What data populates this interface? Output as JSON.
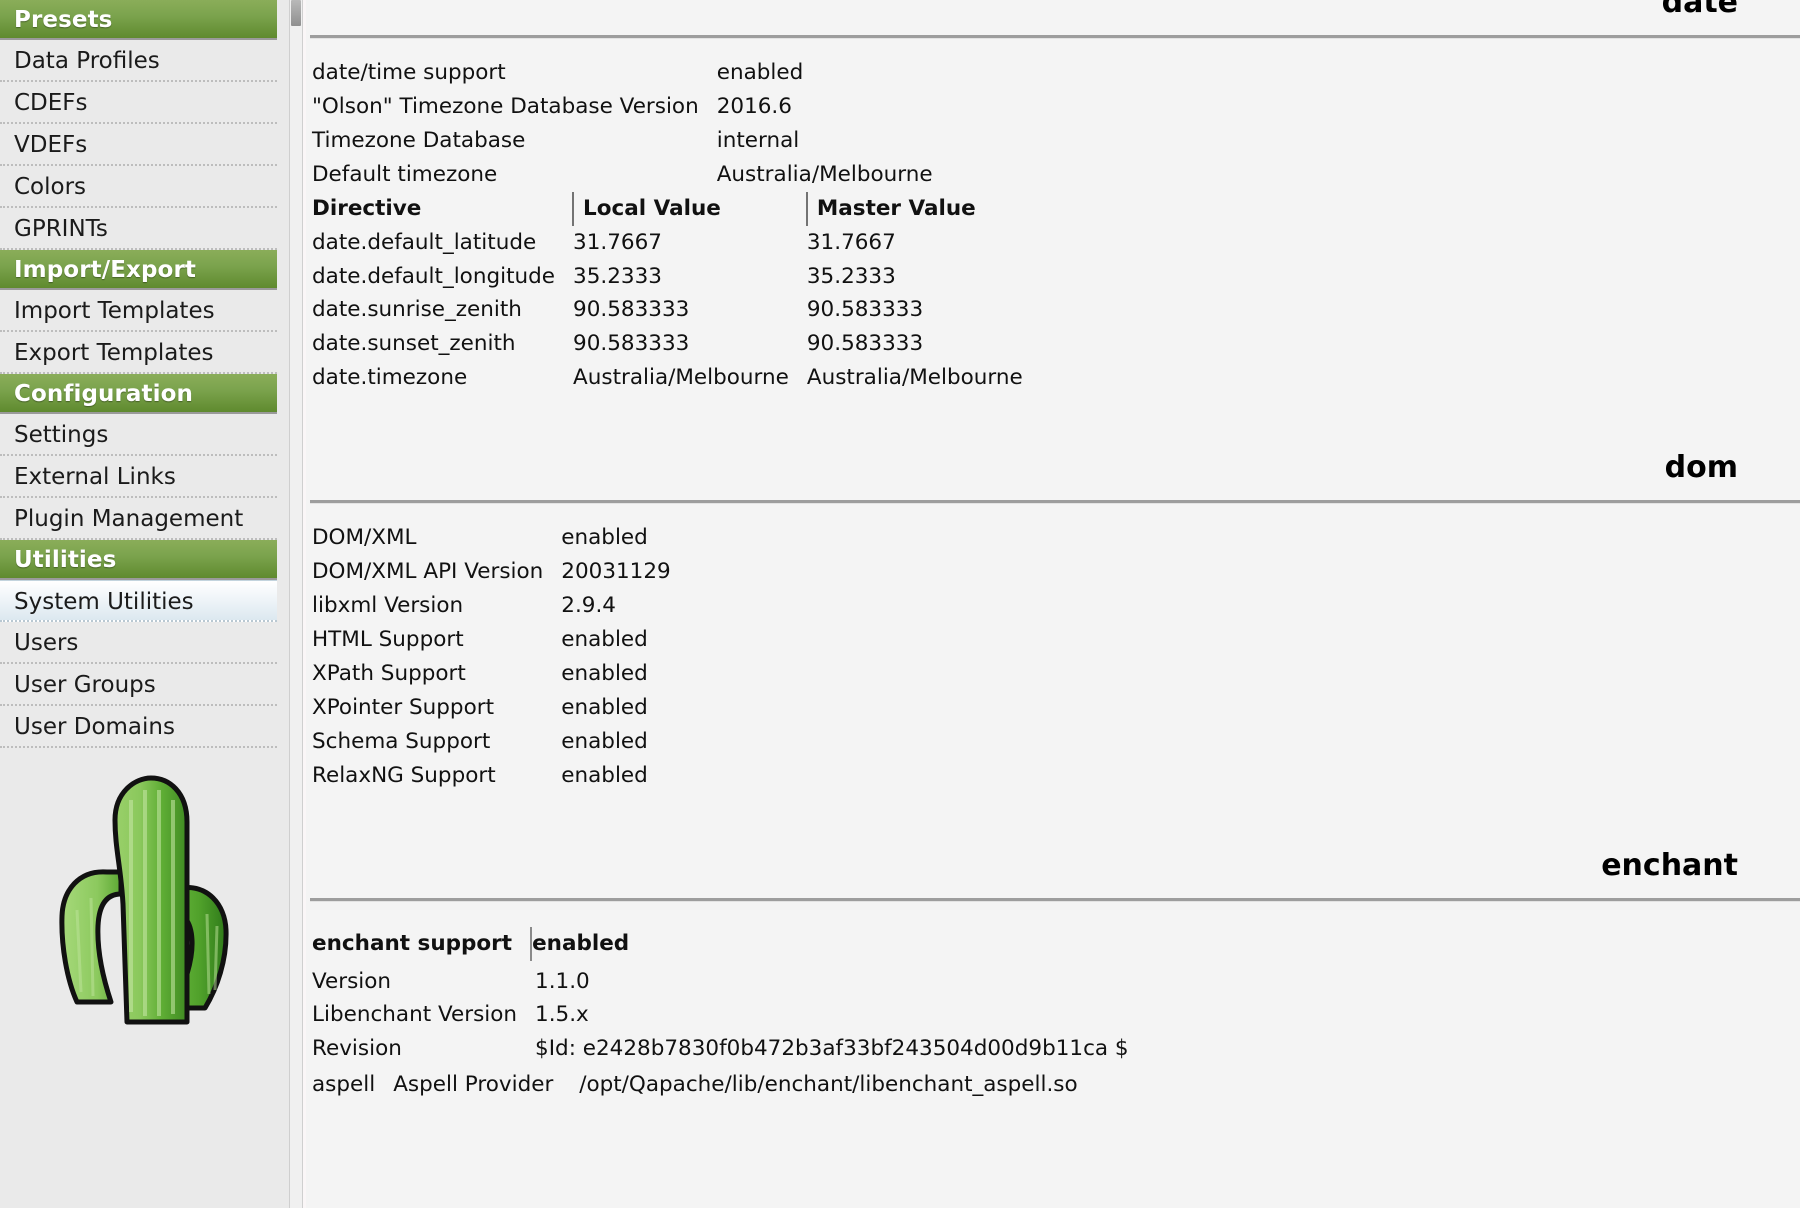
{
  "sidebar": {
    "groups": [
      {
        "type": "header",
        "label": "Presets",
        "name": "sidebar-header-presets"
      },
      {
        "type": "item",
        "label": "Data Profiles",
        "name": "sidebar-item-data-profiles",
        "selected": false
      },
      {
        "type": "item",
        "label": "CDEFs",
        "name": "sidebar-item-cdefs",
        "selected": false
      },
      {
        "type": "item",
        "label": "VDEFs",
        "name": "sidebar-item-vdefs",
        "selected": false
      },
      {
        "type": "item",
        "label": "Colors",
        "name": "sidebar-item-colors",
        "selected": false
      },
      {
        "type": "item",
        "label": "GPRINTs",
        "name": "sidebar-item-gprints",
        "selected": false
      },
      {
        "type": "header",
        "label": "Import/Export",
        "name": "sidebar-header-import-export"
      },
      {
        "type": "item",
        "label": "Import Templates",
        "name": "sidebar-item-import-templates",
        "selected": false
      },
      {
        "type": "item",
        "label": "Export Templates",
        "name": "sidebar-item-export-templates",
        "selected": false
      },
      {
        "type": "header",
        "label": "Configuration",
        "name": "sidebar-header-configuration"
      },
      {
        "type": "item",
        "label": "Settings",
        "name": "sidebar-item-settings",
        "selected": false
      },
      {
        "type": "item",
        "label": "External Links",
        "name": "sidebar-item-external-links",
        "selected": false
      },
      {
        "type": "item",
        "label": "Plugin Management",
        "name": "sidebar-item-plugin-management",
        "selected": false
      },
      {
        "type": "header",
        "label": "Utilities",
        "name": "sidebar-header-utilities"
      },
      {
        "type": "item",
        "label": "System Utilities",
        "name": "sidebar-item-system-utilities",
        "selected": true
      },
      {
        "type": "item",
        "label": "Users",
        "name": "sidebar-item-users",
        "selected": false
      },
      {
        "type": "item",
        "label": "User Groups",
        "name": "sidebar-item-user-groups",
        "selected": false
      },
      {
        "type": "item",
        "label": "User Domains",
        "name": "sidebar-item-user-domains",
        "selected": false
      }
    ],
    "logo_alt": "cactus-logo",
    "accent_green": "#6f9a3c",
    "selected_blue": "#dce8f0"
  },
  "content": {
    "sections": [
      {
        "id": "date",
        "title": "date",
        "rows": [
          {
            "cells": [
              "date/time support",
              "enabled"
            ]
          },
          {
            "cells": [
              "\"Olson\" Timezone Database Version",
              "2016.6"
            ]
          },
          {
            "cells": [
              "Timezone Database",
              "internal"
            ]
          },
          {
            "cells": [
              "Default timezone",
              "Australia/Melbourne"
            ]
          }
        ],
        "table_headers": [
          "Directive",
          "Local Value",
          "Master Value"
        ],
        "directives": [
          {
            "cells": [
              "date.default_latitude",
              "31.7667",
              "31.7667"
            ]
          },
          {
            "cells": [
              "date.default_longitude",
              "35.2333",
              "35.2333"
            ]
          },
          {
            "cells": [
              "date.sunrise_zenith",
              "90.583333",
              "90.583333"
            ]
          },
          {
            "cells": [
              "date.sunset_zenith",
              "90.583333",
              "90.583333"
            ]
          },
          {
            "cells": [
              "date.timezone",
              "Australia/Melbourne",
              "Australia/Melbourne"
            ]
          }
        ]
      },
      {
        "id": "dom",
        "title": "dom",
        "rows": [
          {
            "cells": [
              "DOM/XML",
              "enabled"
            ]
          },
          {
            "cells": [
              "DOM/XML API Version",
              "20031129"
            ]
          },
          {
            "cells": [
              "libxml Version",
              "2.9.4"
            ]
          },
          {
            "cells": [
              "HTML Support",
              "enabled"
            ]
          },
          {
            "cells": [
              "XPath Support",
              "enabled"
            ]
          },
          {
            "cells": [
              "XPointer Support",
              "enabled"
            ]
          },
          {
            "cells": [
              "Schema Support",
              "enabled"
            ]
          },
          {
            "cells": [
              "RelaxNG Support",
              "enabled"
            ]
          }
        ]
      },
      {
        "id": "enchant",
        "title": "enchant",
        "bold_row": {
          "cells": [
            "enchant support",
            "enabled"
          ]
        },
        "rows": [
          {
            "cells": [
              "Version",
              "1.1.0"
            ]
          },
          {
            "cells": [
              "Libenchant Version",
              "1.5.x"
            ]
          },
          {
            "cells": [
              "Revision",
              "$Id: e2428b7830f0b472b3af33bf243504d00d9b11ca $"
            ]
          }
        ],
        "provider_row": {
          "cells": [
            "aspell",
            "Aspell Provider",
            "/opt/Qapache/lib/enchant/libenchant_aspell.so"
          ]
        }
      }
    ]
  },
  "scrollbar": {
    "name": "vertical-scrollbar",
    "position": "top"
  }
}
